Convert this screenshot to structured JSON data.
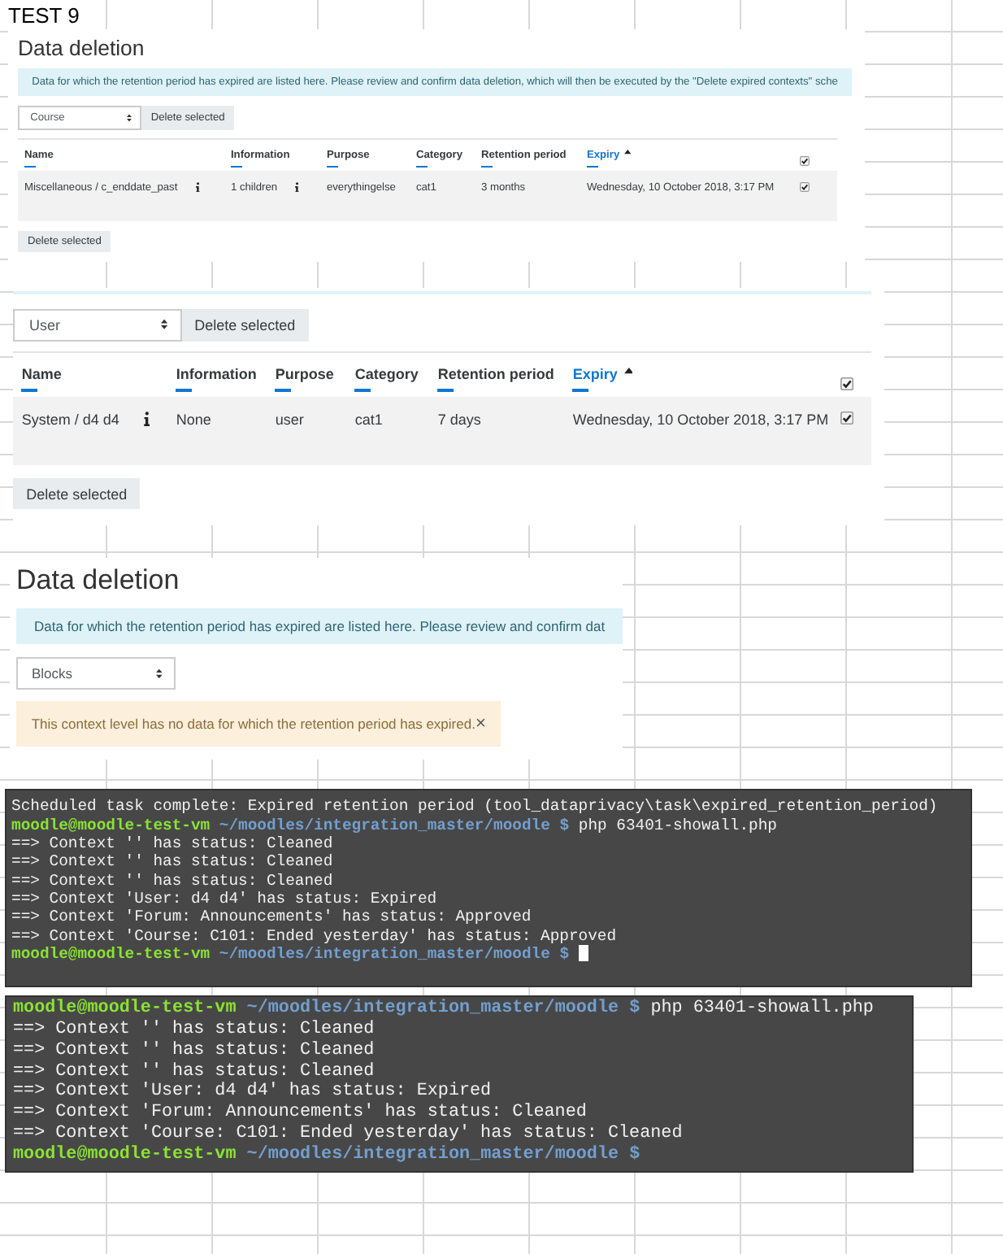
{
  "sheet_label": "TEST 9",
  "panels": [
    {
      "kind": "table",
      "heading": "Data deletion",
      "notice": "Data for which the retention period has expired are listed here. Please review and confirm data deletion, which will then be executed by the \"Delete expired contexts\" sche",
      "context_select": "Course",
      "delete_button": "Delete selected",
      "columns": [
        {
          "label": "Name",
          "sorted": false
        },
        {
          "label": "Information",
          "sorted": false
        },
        {
          "label": "Purpose",
          "sorted": false
        },
        {
          "label": "Category",
          "sorted": false
        },
        {
          "label": "Retention period",
          "sorted": false
        },
        {
          "label": "Expiry",
          "sorted": true
        }
      ],
      "select_all_checked": true,
      "rows": [
        {
          "cells": [
            {
              "text": "Miscellaneous / c_enddate_past",
              "info": true
            },
            {
              "text": "1 children",
              "info": true
            },
            {
              "text": "everythingelse",
              "info": false
            },
            {
              "text": "cat1",
              "info": false
            },
            {
              "text": "3 months",
              "info": false
            },
            {
              "text": "Wednesday, 10 October 2018, 3:17 PM",
              "info": false
            }
          ],
          "checked": true
        }
      ],
      "bottom_button": "Delete selected"
    },
    {
      "kind": "table",
      "context_select": "User",
      "delete_button": "Delete selected",
      "columns": [
        {
          "label": "Name",
          "sorted": false
        },
        {
          "label": "Information",
          "sorted": false
        },
        {
          "label": "Purpose",
          "sorted": false
        },
        {
          "label": "Category",
          "sorted": false
        },
        {
          "label": "Retention period",
          "sorted": false
        },
        {
          "label": "Expiry",
          "sorted": true
        }
      ],
      "select_all_checked": true,
      "rows": [
        {
          "cells": [
            {
              "text": "System / d4 d4",
              "info": true
            },
            {
              "text": "None",
              "info": false
            },
            {
              "text": "user",
              "info": false
            },
            {
              "text": "cat1",
              "info": false
            },
            {
              "text": "7 days",
              "info": false
            },
            {
              "text": "Wednesday, 10 October 2018, 3:17 PM",
              "info": false
            }
          ],
          "checked": true
        }
      ],
      "bottom_button": "Delete selected"
    },
    {
      "kind": "empty",
      "heading": "Data deletion",
      "notice": "Data for which the retention period has expired are listed here. Please review and confirm dat",
      "context_select": "Blocks",
      "alert": "This context level has no data for which the retention period has expired.",
      "alert_close": "×"
    }
  ],
  "terminals": [
    {
      "lines": [
        {
          "kind": "output",
          "text": "Scheduled task complete: Expired retention period (tool_dataprivacy\\task\\expired_retention_period)"
        },
        {
          "kind": "prompt",
          "user": "moodle@moodle-test-vm",
          "path": "~/moodles/integration_master/moodle",
          "symbol": "$",
          "command": "php 63401-showall.php",
          "cursor": false
        },
        {
          "kind": "output",
          "text": "==> Context '' has status: Cleaned"
        },
        {
          "kind": "output",
          "text": "==> Context '' has status: Cleaned"
        },
        {
          "kind": "output",
          "text": "==> Context '' has status: Cleaned"
        },
        {
          "kind": "output",
          "text": "==> Context 'User: d4 d4' has status: Expired"
        },
        {
          "kind": "output",
          "text": "==> Context 'Forum: Announcements' has status: Approved"
        },
        {
          "kind": "output",
          "text": "==> Context 'Course: C101: Ended yesterday' has status: Approved"
        },
        {
          "kind": "prompt",
          "user": "moodle@moodle-test-vm",
          "path": "~/moodles/integration_master/moodle",
          "symbol": "$",
          "cursor": true
        }
      ]
    },
    {
      "lines": [
        {
          "kind": "prompt",
          "user": "moodle@moodle-test-vm",
          "path": "~/moodles/integration_master/moodle",
          "symbol": "$",
          "command": "php 63401-showall.php",
          "cursor": false
        },
        {
          "kind": "output",
          "text": "==> Context '' has status: Cleaned"
        },
        {
          "kind": "output",
          "text": "==> Context '' has status: Cleaned"
        },
        {
          "kind": "output",
          "text": "==> Context '' has status: Cleaned"
        },
        {
          "kind": "output",
          "text": "==> Context 'User: d4 d4' has status: Expired"
        },
        {
          "kind": "output",
          "text": "==> Context 'Forum: Announcements' has status: Cleaned"
        },
        {
          "kind": "output",
          "text": "==> Context 'Course: C101: Ended yesterday' has status: Cleaned"
        },
        {
          "kind": "prompt",
          "user": "moodle@moodle-test-vm",
          "path": "~/moodles/integration_master/moodle",
          "symbol": "$",
          "cursor": false
        }
      ]
    }
  ]
}
